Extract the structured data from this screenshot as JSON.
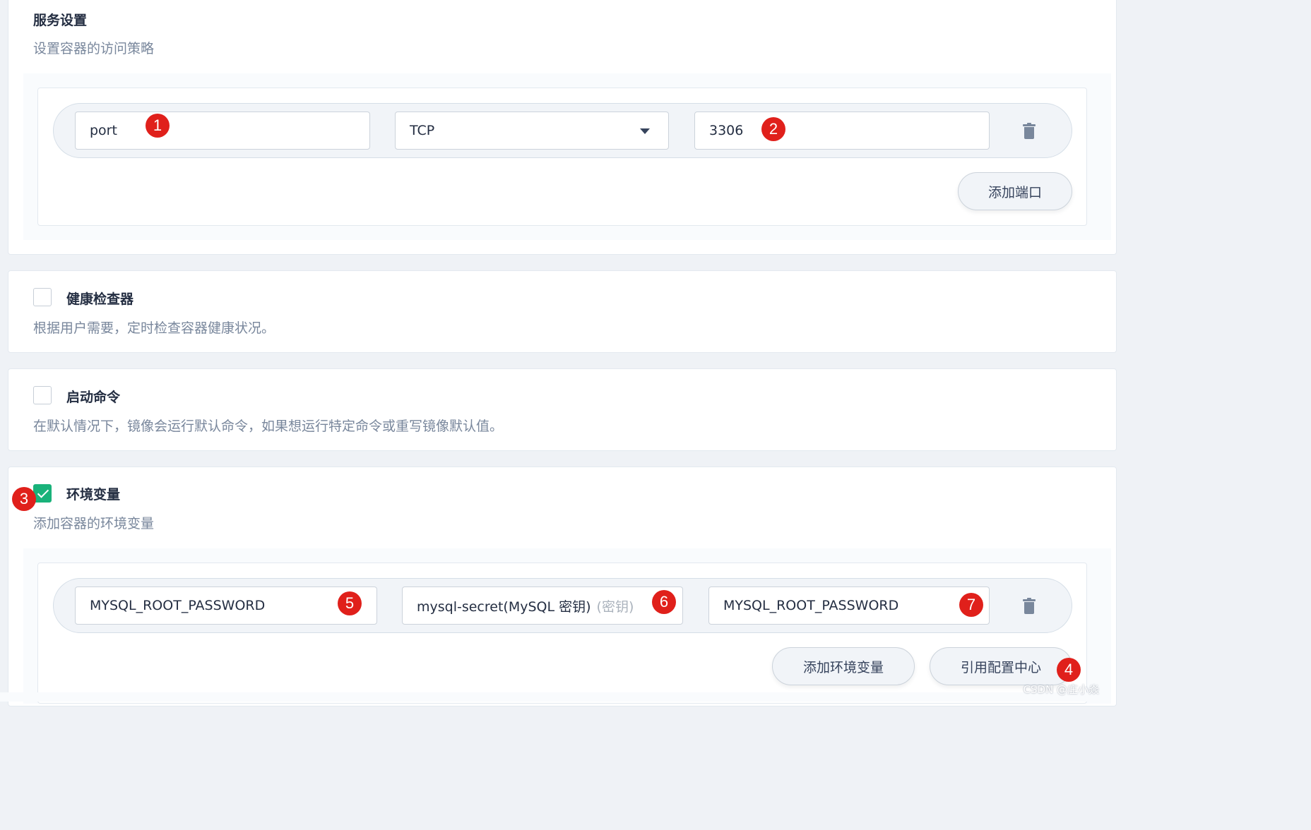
{
  "service": {
    "title": "服务设置",
    "desc": "设置容器的访问策略",
    "port_row": {
      "name_value": "port",
      "protocol_value": "TCP",
      "port_value": "3306"
    },
    "add_port_label": "添加端口"
  },
  "health": {
    "title": "健康检查器",
    "desc": "根据用户需要，定时检查容器健康状况。",
    "checked": false
  },
  "startup": {
    "title": "启动命令",
    "desc": "在默认情况下，镜像会运行默认命令，如果想运行特定命令或重写镜像默认值。",
    "checked": false
  },
  "env": {
    "title": "环境变量",
    "desc": "添加容器的环境变量",
    "checked": true,
    "row": {
      "name_value": "MYSQL_ROOT_PASSWORD",
      "secret_value": "mysql-secret(MySQL 密钥)",
      "secret_hint": "(密钥)",
      "key_value": "MYSQL_ROOT_PASSWORD"
    },
    "add_env_label": "添加环境变量",
    "ref_config_label": "引用配置中心"
  },
  "annotations": [
    "1",
    "2",
    "3",
    "4",
    "5",
    "6",
    "7"
  ],
  "watermark": "CSDN @庄小焱",
  "colors": {
    "accent_green": "#19b27a",
    "annotation_red": "#e0201b"
  },
  "icons": {
    "protocol_dropdown": "chevron-down-icon",
    "delete_row": "trash-icon",
    "checkbox_checked": "check-icon"
  }
}
